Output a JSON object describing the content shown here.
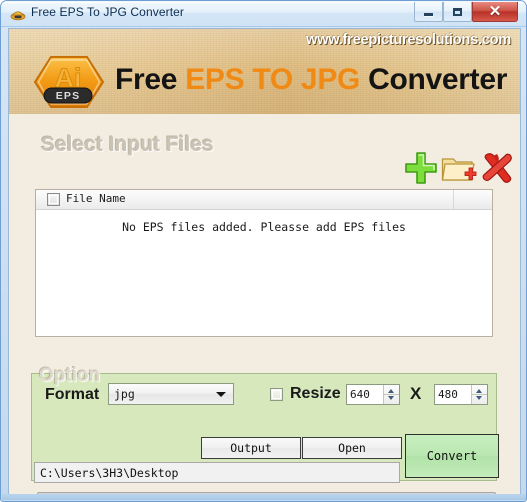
{
  "window": {
    "title": "Free EPS To JPG Converter",
    "app_icon": "app-icon",
    "buttons": {
      "minimize": "minimize",
      "maximize": "maximize",
      "close": "✕"
    }
  },
  "header": {
    "site_url": "www.freepicturesolutions.com",
    "logo": {
      "mark": "Ai",
      "badge": "EPS"
    },
    "product_title": {
      "part1": "Free ",
      "part2": "EPS TO JPG",
      "part3": " Converter"
    }
  },
  "input_section": {
    "title": "Select Input Files",
    "icons": {
      "add": "add-files-icon",
      "folder": "add-folder-icon",
      "clear": "clear-list-icon"
    }
  },
  "file_list": {
    "column_header": "File Name",
    "select_all_checked": false,
    "empty_message": "No EPS files added. Pleasse add EPS files"
  },
  "options": {
    "legend": "Option",
    "format_label": "Format",
    "format_value": "jpg",
    "format_options": [
      "jpg"
    ],
    "resize_label": "Resize",
    "resize_checked": false,
    "width": "640",
    "height": "480",
    "dimension_separator": "X"
  },
  "actions": {
    "output": "Output",
    "open": "Open",
    "convert": "Convert"
  },
  "output_path": {
    "value": "C:\\Users\\3H3\\Desktop",
    "placeholder": "C:\\Users\\3H3\\Desktop"
  },
  "progress": {
    "percent": 0
  },
  "colors": {
    "accent_orange": "#f08a14",
    "header_tan": "#e0c08a",
    "option_green": "#d6e8bc",
    "convert_green": "#b9e7b0",
    "close_red": "#c34a3c"
  }
}
